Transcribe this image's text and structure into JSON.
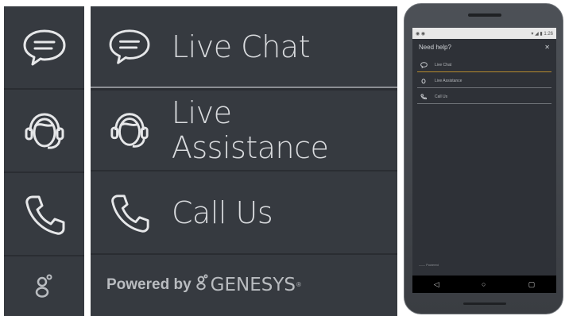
{
  "menu": {
    "items": [
      {
        "label": "Live Chat",
        "icon": "chat-bubble-icon"
      },
      {
        "label": "Live Assistance",
        "icon": "agent-headset-icon"
      },
      {
        "label": "Call Us",
        "icon": "phone-icon"
      }
    ],
    "powered_by": "Powered by",
    "brand": "GENESYS",
    "registered": "®"
  },
  "sidebar_icons": [
    "chat-bubble-icon",
    "agent-headset-icon",
    "phone-icon",
    "genesys-logo-icon"
  ],
  "phone": {
    "header_title": "Need help?",
    "close_glyph": "✕",
    "status_left": "◉ ◉",
    "status_right": "▾ ◢ ▮ 1:26",
    "items": [
      {
        "label": "Live Chat"
      },
      {
        "label": "Live Assistance"
      },
      {
        "label": "Call Us"
      }
    ],
    "powered_text": "—— Powered",
    "nav": {
      "back": "◁",
      "home": "○",
      "recent": "▢"
    }
  },
  "colors": {
    "panel_bg": "#363a40",
    "text": "#d9dbde",
    "highlight_separator": "#8b8e93",
    "accent": "#b68a2e"
  }
}
